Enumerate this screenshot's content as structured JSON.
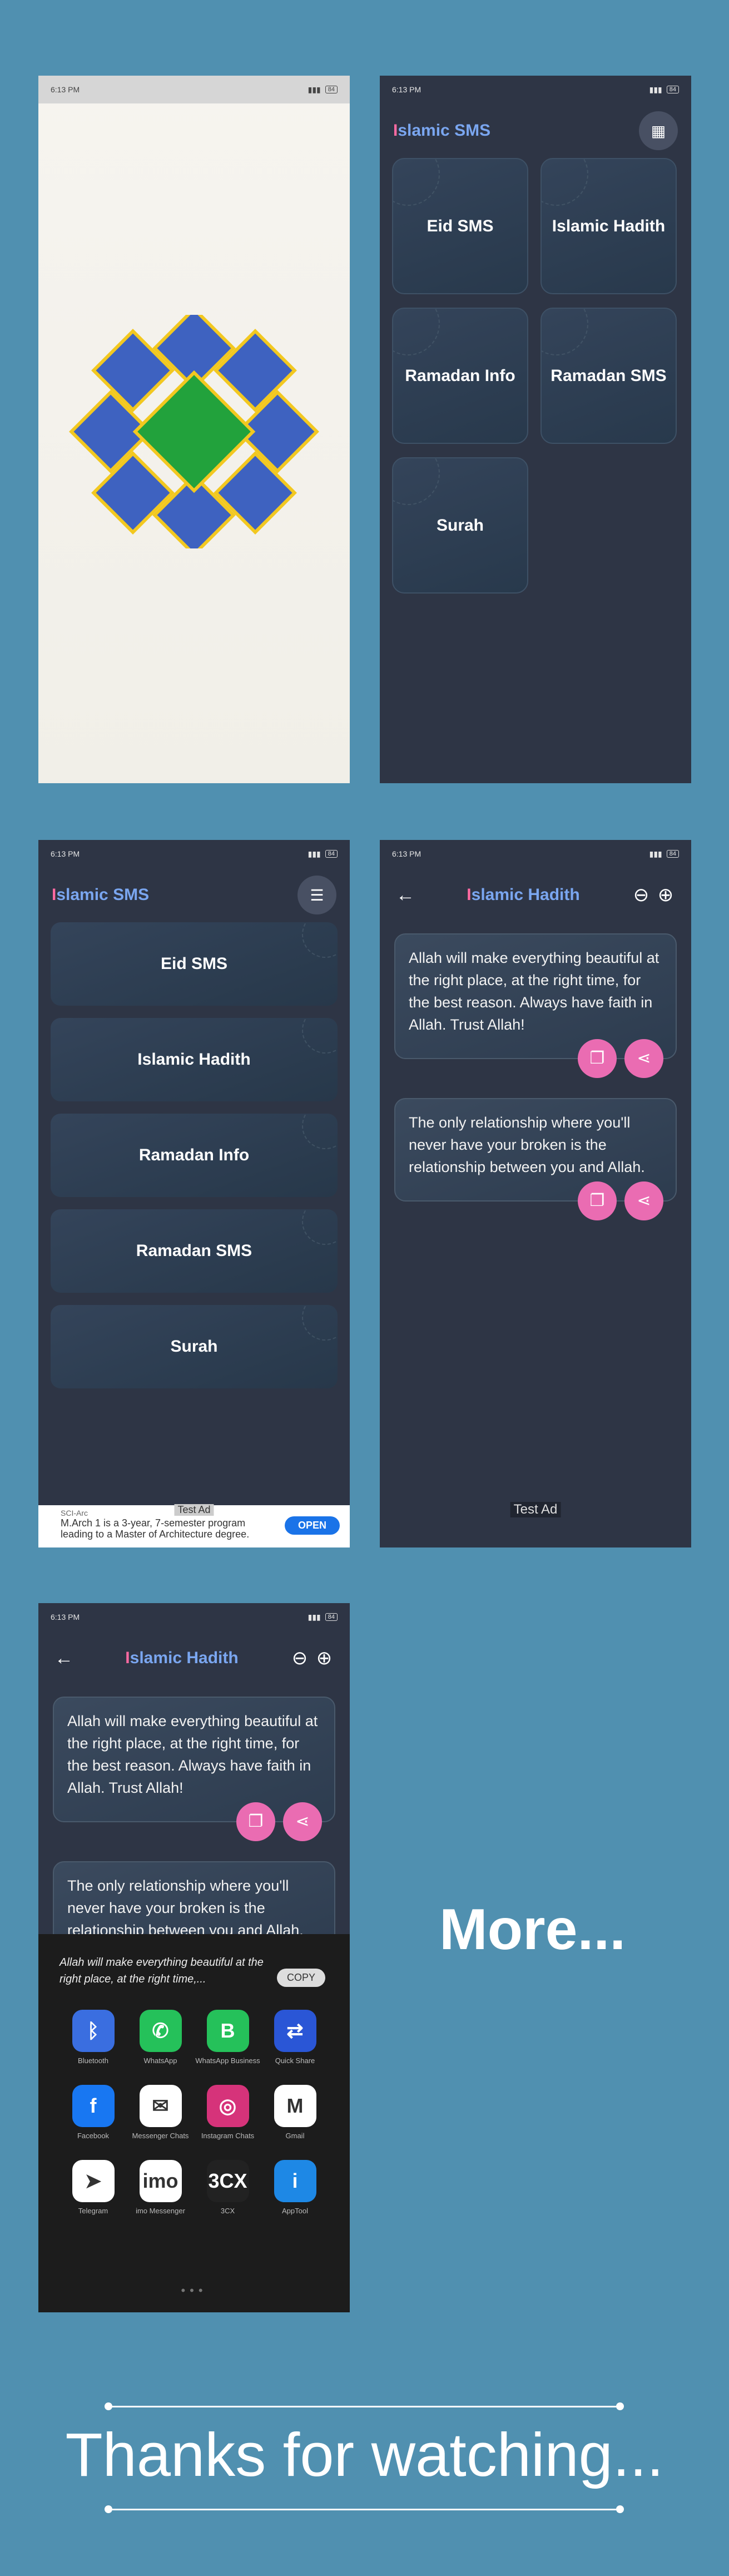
{
  "status": {
    "time": "6:13 PM",
    "battery": "84"
  },
  "brand": {
    "first": "I",
    "rest": "slamic SMS"
  },
  "categories": [
    "Eid SMS",
    "Islamic Hadith",
    "Ramadan Info",
    "Ramadan SMS",
    "Surah"
  ],
  "detail": {
    "title_first": "I",
    "title_rest": "slamic Hadith"
  },
  "messages": [
    "Allah will make everything beautiful at the right place, at the right time, for the best reason. Always have faith in Allah. Trust Allah!",
    "The only relationship where you'll never have your broken is the relationship between you and Allah."
  ],
  "ad": {
    "label": "Test Ad",
    "sponsor": "SCI-Arc",
    "text": "M.Arch 1 is a 3-year, 7-semester program leading to a Master of Architecture degree.",
    "cta": "OPEN"
  },
  "share": {
    "preview": "Allah will make everything beautiful at the right place, at the right time,...",
    "copy": "COPY",
    "apps": [
      {
        "name": "Bluetooth",
        "color": "#3a6ee0",
        "glyph": "ᛒ"
      },
      {
        "name": "WhatsApp",
        "color": "#25c15a",
        "glyph": "✆"
      },
      {
        "name": "WhatsApp Business",
        "color": "#25c15a",
        "glyph": "B"
      },
      {
        "name": "Quick Share",
        "color": "#2a56d6",
        "glyph": "⇄"
      },
      {
        "name": "Facebook",
        "color": "#1877f2",
        "glyph": "f"
      },
      {
        "name": "Messenger Chats",
        "color": "#ffffff",
        "glyph": "✉"
      },
      {
        "name": "Instagram Chats",
        "color": "#d6337a",
        "glyph": "◎"
      },
      {
        "name": "Gmail",
        "color": "#ffffff",
        "glyph": "M"
      },
      {
        "name": "Telegram",
        "color": "#ffffff",
        "glyph": "➤"
      },
      {
        "name": "imo Messenger",
        "color": "#ffffff",
        "glyph": "imo"
      },
      {
        "name": "3CX",
        "color": "#222222",
        "glyph": "3CX"
      },
      {
        "name": "AppTool",
        "color": "#1e88e5",
        "glyph": "i"
      }
    ]
  },
  "footer": {
    "more": "More...",
    "thanks": "Thanks for watching..."
  }
}
